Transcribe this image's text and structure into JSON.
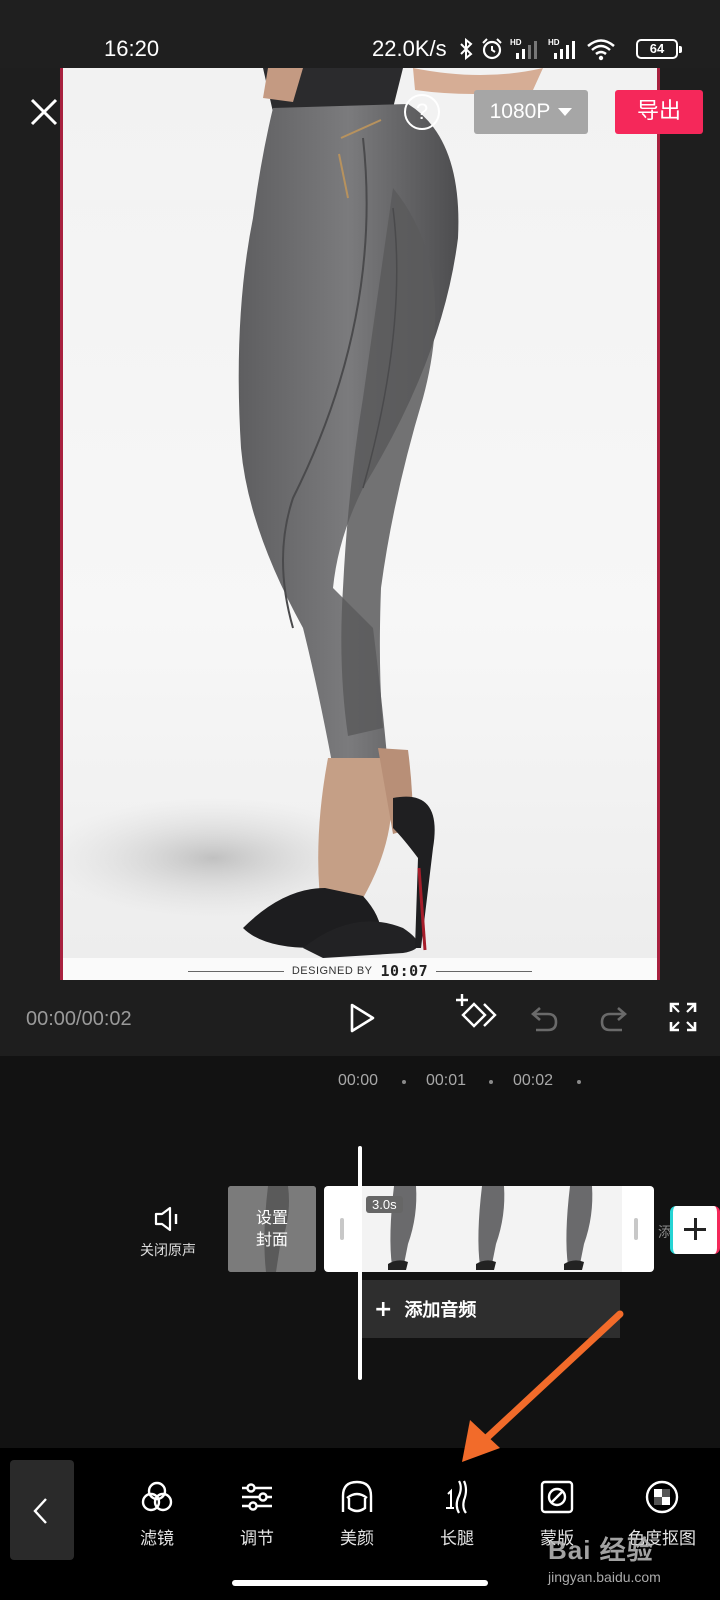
{
  "status_bar": {
    "time": "16:20",
    "net_speed": "22.0K/s",
    "battery": "64"
  },
  "top_bar": {
    "help_label": "?",
    "resolution": "1080P",
    "export_label": "导出"
  },
  "preview": {
    "footer_text": "DESIGNED BY",
    "footer_mark": "10:07"
  },
  "playback": {
    "timecode": "00:00/00:02"
  },
  "timeline": {
    "ruler": [
      "00:00",
      "00:01",
      "00:02"
    ],
    "mute_label": "关闭原声",
    "cover_label": "设置封面",
    "clip_duration": "3.0s",
    "next_clip_stub": "添",
    "add_audio_label": "添加音频"
  },
  "toolbar": {
    "items": [
      {
        "label": "滤镜",
        "icon": "filter-icon"
      },
      {
        "label": "调节",
        "icon": "adjust-icon"
      },
      {
        "label": "美颜",
        "icon": "beauty-icon"
      },
      {
        "label": "长腿",
        "icon": "long-legs-icon"
      },
      {
        "label": "蒙版",
        "icon": "mask-icon"
      },
      {
        "label": "色度抠图",
        "icon": "chroma-key-icon"
      }
    ]
  },
  "watermark": {
    "brand": "Bai 经验",
    "site": "jingyan.baidu.com"
  },
  "colors": {
    "accent": "#f5285a",
    "annotation_arrow": "#f26b2a"
  }
}
